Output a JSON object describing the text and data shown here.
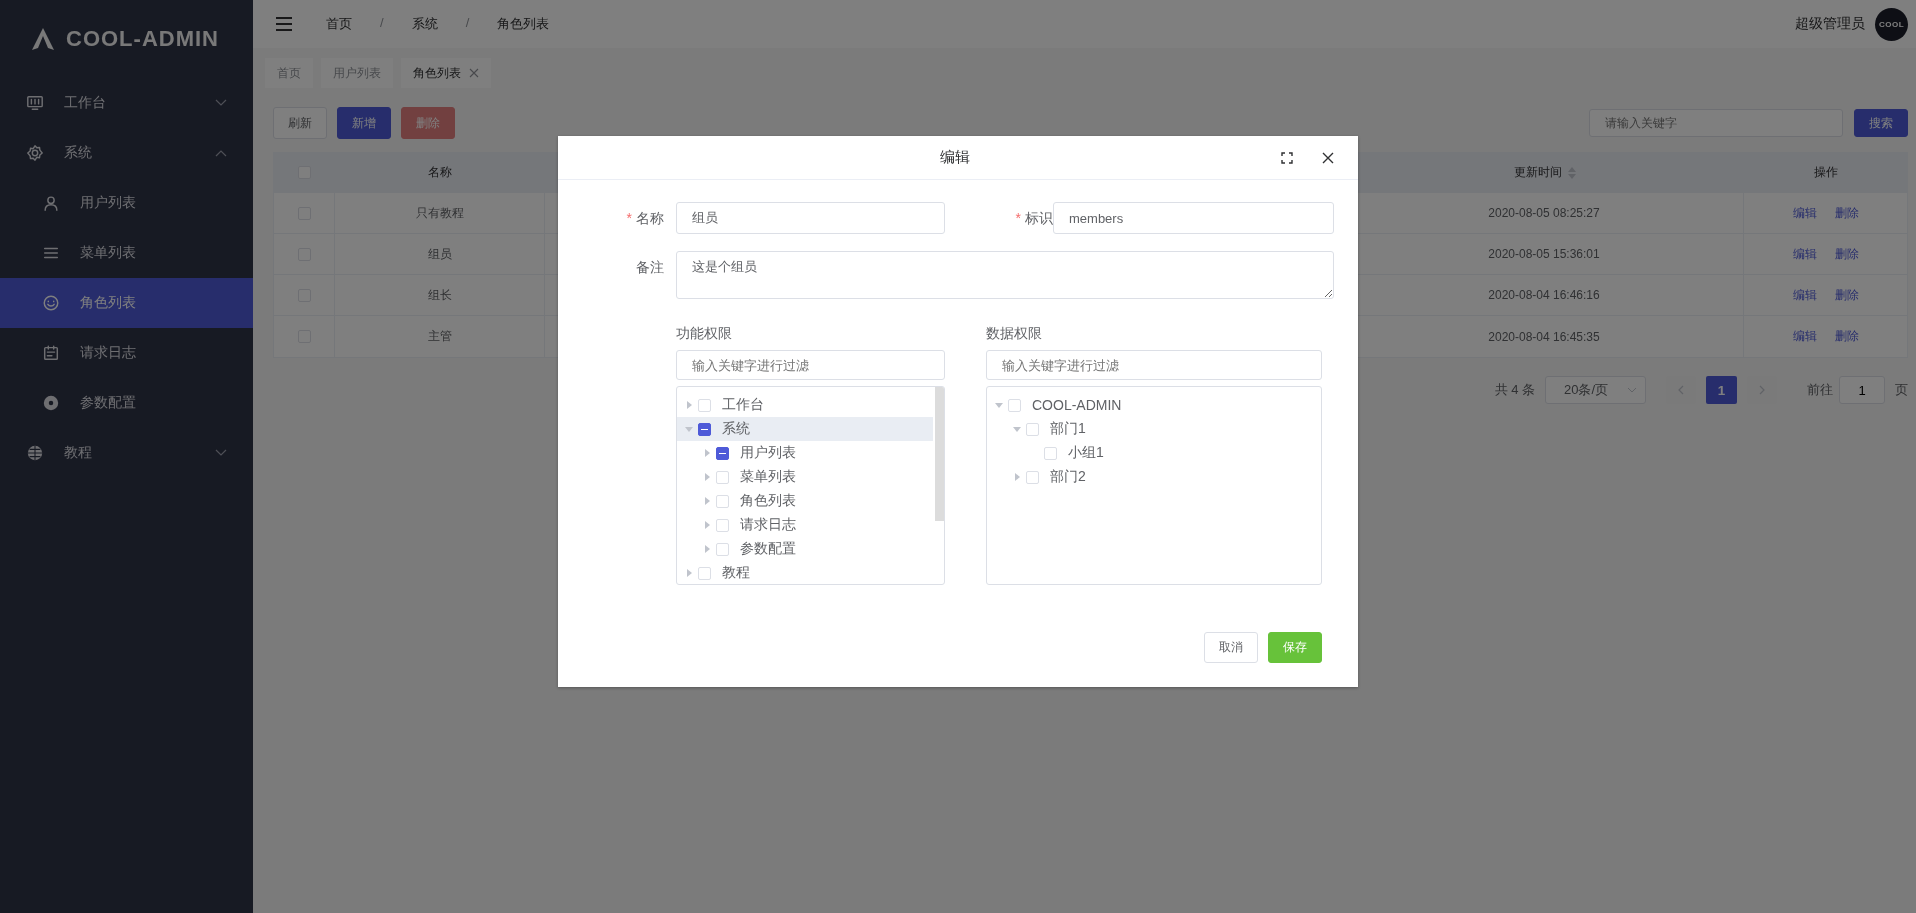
{
  "sidebar": {
    "logo": "COOL-ADMIN",
    "menu": [
      {
        "label": "工作台",
        "expanded": false,
        "selected": false
      },
      {
        "label": "系统",
        "expanded": true,
        "selected": false,
        "children": [
          {
            "label": "用户列表",
            "selected": false
          },
          {
            "label": "菜单列表",
            "selected": false
          },
          {
            "label": "角色列表",
            "selected": true
          },
          {
            "label": "请求日志",
            "selected": false
          },
          {
            "label": "参数配置",
            "selected": false
          }
        ]
      },
      {
        "label": "教程",
        "expanded": false,
        "selected": false
      }
    ]
  },
  "header": {
    "breadcrumb": [
      "首页",
      "系统",
      "角色列表"
    ],
    "separator": "/",
    "user": "超级管理员",
    "avatar_text": "COOL"
  },
  "tabs": [
    {
      "label": "首页",
      "selected": false
    },
    {
      "label": "用户列表",
      "selected": false
    },
    {
      "label": "角色列表",
      "selected": true
    }
  ],
  "toolbar": {
    "buttons": [
      {
        "label": "刷新",
        "kind": "default",
        "disabled": false
      },
      {
        "label": "新增",
        "kind": "primary",
        "disabled": false
      },
      {
        "label": "删除",
        "kind": "danger",
        "disabled": true
      }
    ],
    "search": {
      "placeholder": "请输入关键字",
      "button": "搜索"
    }
  },
  "table": {
    "all_checked": false,
    "columns": [
      {
        "label": "名称"
      },
      {
        "label": "更新时间",
        "sortable": true
      },
      {
        "label": "操作"
      }
    ],
    "rows": [
      {
        "checked": false,
        "name": "只有教程",
        "updated": "2020-08-05 08:25:27",
        "actions": [
          "编辑",
          "删除"
        ]
      },
      {
        "checked": false,
        "name": "组员",
        "updated": "2020-08-05 15:36:01",
        "actions": [
          "编辑",
          "删除"
        ]
      },
      {
        "checked": false,
        "name": "组长",
        "updated": "2020-08-04 16:46:16",
        "actions": [
          "编辑",
          "删除"
        ]
      },
      {
        "checked": false,
        "name": "主管",
        "updated": "2020-08-04 16:45:35",
        "actions": [
          "编辑",
          "删除"
        ]
      }
    ]
  },
  "pagination": {
    "total": "共 4 条",
    "page_size": "20条/页",
    "prev_disabled": true,
    "next_disabled": true,
    "pages": [
      {
        "label": "1",
        "selected": true
      }
    ],
    "goto_label": "前往",
    "goto_value": "1",
    "goto_suffix": "页"
  },
  "dialog": {
    "title": "编辑",
    "required_mark": "*",
    "fields": [
      {
        "label": "名称",
        "required": true,
        "value": "组员"
      },
      {
        "label": "标识",
        "required": true,
        "value": "members"
      }
    ],
    "remark": {
      "label": "备注",
      "value": "这是个组员"
    },
    "panels": [
      {
        "title": "功能权限",
        "filter_placeholder": "输入关键字进行过滤",
        "scrollable": true,
        "tree": [
          {
            "label": "工作台",
            "expandable": true,
            "expanded": false,
            "checked": false,
            "indeterminate": false,
            "selected": false
          },
          {
            "label": "系统",
            "expandable": true,
            "expanded": true,
            "checked": false,
            "indeterminate": true,
            "selected": true,
            "children": [
              {
                "label": "用户列表",
                "expandable": true,
                "expanded": false,
                "checked": false,
                "indeterminate": true,
                "selected": false
              },
              {
                "label": "菜单列表",
                "expandable": true,
                "expanded": false,
                "checked": false,
                "indeterminate": false,
                "selected": false
              },
              {
                "label": "角色列表",
                "expandable": true,
                "expanded": false,
                "checked": false,
                "indeterminate": false,
                "selected": false
              },
              {
                "label": "请求日志",
                "expandable": true,
                "expanded": false,
                "checked": false,
                "indeterminate": false,
                "selected": false
              },
              {
                "label": "参数配置",
                "expandable": true,
                "expanded": false,
                "checked": false,
                "indeterminate": false,
                "selected": false
              }
            ]
          },
          {
            "label": "教程",
            "expandable": true,
            "expanded": false,
            "checked": false,
            "indeterminate": false,
            "selected": false
          }
        ]
      },
      {
        "title": "数据权限",
        "filter_placeholder": "输入关键字进行过滤",
        "scrollable": false,
        "tree": [
          {
            "label": "COOL-ADMIN",
            "expandable": true,
            "expanded": true,
            "checked": false,
            "indeterminate": false,
            "selected": false,
            "children": [
              {
                "label": "部门1",
                "expandable": true,
                "expanded": true,
                "checked": false,
                "indeterminate": false,
                "selected": false,
                "children": [
                  {
                    "label": "小组1",
                    "expandable": false,
                    "checked": false,
                    "indeterminate": false,
                    "selected": false
                  }
                ]
              },
              {
                "label": "部门2",
                "expandable": true,
                "expanded": false,
                "checked": false,
                "indeterminate": false,
                "selected": false
              }
            ]
          }
        ]
      }
    ],
    "buttons": [
      {
        "label": "取消",
        "kind": "default"
      },
      {
        "label": "保存",
        "kind": "success"
      }
    ]
  }
}
